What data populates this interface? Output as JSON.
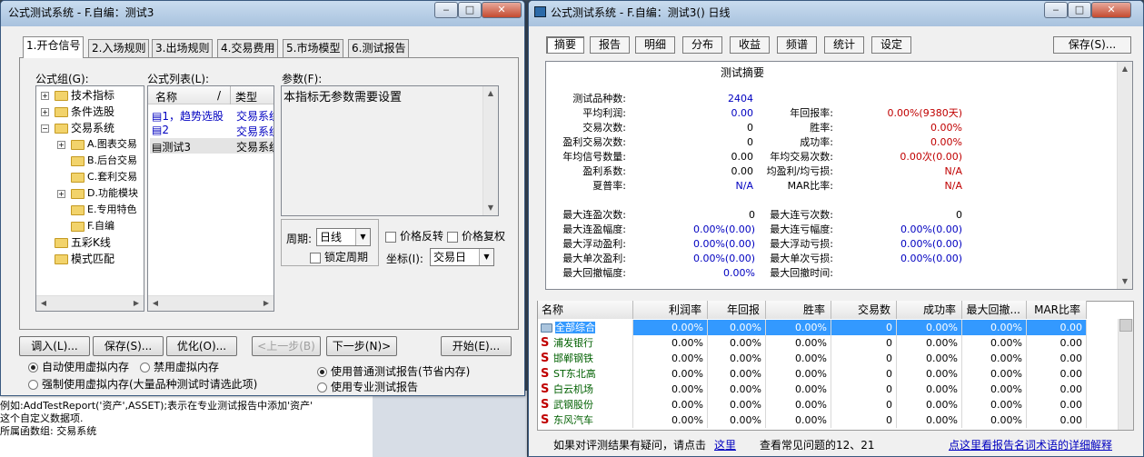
{
  "left_window": {
    "title": "公式测试系统 - F.自编：测试3",
    "tabs": [
      "1.开仓信号",
      "2.入场规则",
      "3.出场规则",
      "4.交易费用",
      "5.市场模型",
      "6.测试报告"
    ],
    "group_label": "公式组(G):",
    "list_label": "公式列表(L):",
    "param_label": "参数(F):",
    "tree": [
      {
        "label": "技术指标",
        "expander": "+"
      },
      {
        "label": "条件选股",
        "expander": "+"
      },
      {
        "label": "交易系统",
        "expander": "-"
      },
      {
        "label": "A.图表交易",
        "expander": "+"
      },
      {
        "label": "B.后台交易",
        "expander": ""
      },
      {
        "label": "C.套利交易",
        "expander": ""
      },
      {
        "label": "D.功能模块",
        "expander": "+"
      },
      {
        "label": "E.专用特色",
        "expander": ""
      },
      {
        "label": "F.自编",
        "expander": ""
      },
      {
        "label": "五彩K线",
        "expander": ""
      },
      {
        "label": "模式匹配",
        "expander": ""
      }
    ],
    "list_headers": {
      "name": "名称",
      "sep": "/",
      "type": "类型"
    },
    "list_rows": [
      {
        "name": "1，趋势选股",
        "type": "交易系统"
      },
      {
        "name": "2",
        "type": "交易系统"
      },
      {
        "name": "测试3",
        "type": "交易系统"
      }
    ],
    "param_text": "本指标无参数需要设置",
    "period_label": "周期:",
    "period_value": "日线",
    "price_reverse": "价格反转",
    "price_recover": "价格复权",
    "lock_period": "锁定周期",
    "coord_label": "坐标(I):",
    "coord_value": "交易日",
    "buttons": {
      "load": "调入(L)...",
      "save": "保存(S)...",
      "optimize": "优化(O)...",
      "prev": "<上一步(B)",
      "next": "下一步(N)>",
      "start": "开始(E)..."
    },
    "radio_auto": "自动使用虚拟内存",
    "radio_disable": "禁用虚拟内存",
    "radio_force": "强制使用虚拟内存(大量品种测试时请选此项)",
    "radio_normal_report": "使用普通测试报告(节省内存)",
    "radio_pro_report": "使用专业测试报告"
  },
  "background_text": {
    "line1": "例如:AddTestReport('资产',ASSET);表示在专业测试报告中添加'资产'",
    "line2": "这个自定义数据项.",
    "line3": "所属函数组: 交易系统"
  },
  "right_window": {
    "title": "公式测试系统 - F.自编：测试3() 日线",
    "tabs": [
      "摘要",
      "报告",
      "明细",
      "分布",
      "收益",
      "频谱",
      "统计",
      "设定"
    ],
    "save_button": "保存(S)...",
    "summary_title": "测试摘要",
    "summary_left": [
      {
        "label": "测试品种数:",
        "value": "2404"
      },
      {
        "label": "平均利润:",
        "value": "0.00"
      },
      {
        "label": "交易次数:",
        "value": "0"
      },
      {
        "label": "盈利交易次数:",
        "value": "0"
      },
      {
        "label": "年均信号数量:",
        "value": "0.00"
      },
      {
        "label": "盈利系数:",
        "value": "0.00"
      },
      {
        "label": "夏普率:",
        "value": "N/A"
      }
    ],
    "summary_right": [
      {
        "label": "年回报率:",
        "value": "0.00%(9380天)"
      },
      {
        "label": "胜率:",
        "value": "0.00%"
      },
      {
        "label": "成功率:",
        "value": "0.00%"
      },
      {
        "label": "年均交易次数:",
        "value": "0.00次(0.00)"
      },
      {
        "label": "均盈利/均亏损:",
        "value": "N/A"
      },
      {
        "label": "MAR比率:",
        "value": "N/A"
      }
    ],
    "streak_left": [
      {
        "label": "最大连盈次数:",
        "value": "0"
      },
      {
        "label": "最大连盈幅度:",
        "value": "0.00%(0.00)"
      },
      {
        "label": "最大浮动盈利:",
        "value": "0.00%(0.00)"
      },
      {
        "label": "最大单次盈利:",
        "value": "0.00%(0.00)"
      },
      {
        "label": "最大回撤幅度:",
        "value": "0.00%"
      }
    ],
    "streak_right": [
      {
        "label": "最大连亏次数:",
        "value": "0"
      },
      {
        "label": "最大连亏幅度:",
        "value": "0.00%(0.00)"
      },
      {
        "label": "最大浮动亏损:",
        "value": "0.00%(0.00)"
      },
      {
        "label": "最大单次亏损:",
        "value": "0.00%(0.00)"
      },
      {
        "label": "最大回撤时间:",
        "value": ""
      }
    ],
    "table_headers": [
      "名称",
      "利润率",
      "年回报",
      "胜率",
      "交易数",
      "成功率",
      "最大回撤...",
      "MAR比率"
    ],
    "table_rows": [
      {
        "name": "全部综合",
        "cells": [
          "0.00%",
          "0.00%",
          "0.00%",
          "0",
          "0.00%",
          "0.00%",
          "0.00"
        ]
      },
      {
        "name": "浦发银行",
        "cells": [
          "0.00%",
          "0.00%",
          "0.00%",
          "0",
          "0.00%",
          "0.00%",
          "0.00"
        ]
      },
      {
        "name": "邯郸钢铁",
        "cells": [
          "0.00%",
          "0.00%",
          "0.00%",
          "0",
          "0.00%",
          "0.00%",
          "0.00"
        ]
      },
      {
        "name": "ST东北高",
        "cells": [
          "0.00%",
          "0.00%",
          "0.00%",
          "0",
          "0.00%",
          "0.00%",
          "0.00"
        ]
      },
      {
        "name": "白云机场",
        "cells": [
          "0.00%",
          "0.00%",
          "0.00%",
          "0",
          "0.00%",
          "0.00%",
          "0.00"
        ]
      },
      {
        "name": "武钢股份",
        "cells": [
          "0.00%",
          "0.00%",
          "0.00%",
          "0",
          "0.00%",
          "0.00%",
          "0.00"
        ]
      },
      {
        "name": "东风汽车",
        "cells": [
          "0.00%",
          "0.00%",
          "0.00%",
          "0",
          "0.00%",
          "0.00%",
          "0.00"
        ]
      }
    ],
    "footer_prefix": "如果对评测结果有疑问，请点击",
    "footer_link": "这里",
    "footer_mid": "查看常见问题的12、21",
    "footer_right_link": "点这里看报告名词术语的详细解释"
  },
  "colors": {
    "link": "#0000c0",
    "value_red": "#c00000",
    "selected": "#3399ff"
  }
}
